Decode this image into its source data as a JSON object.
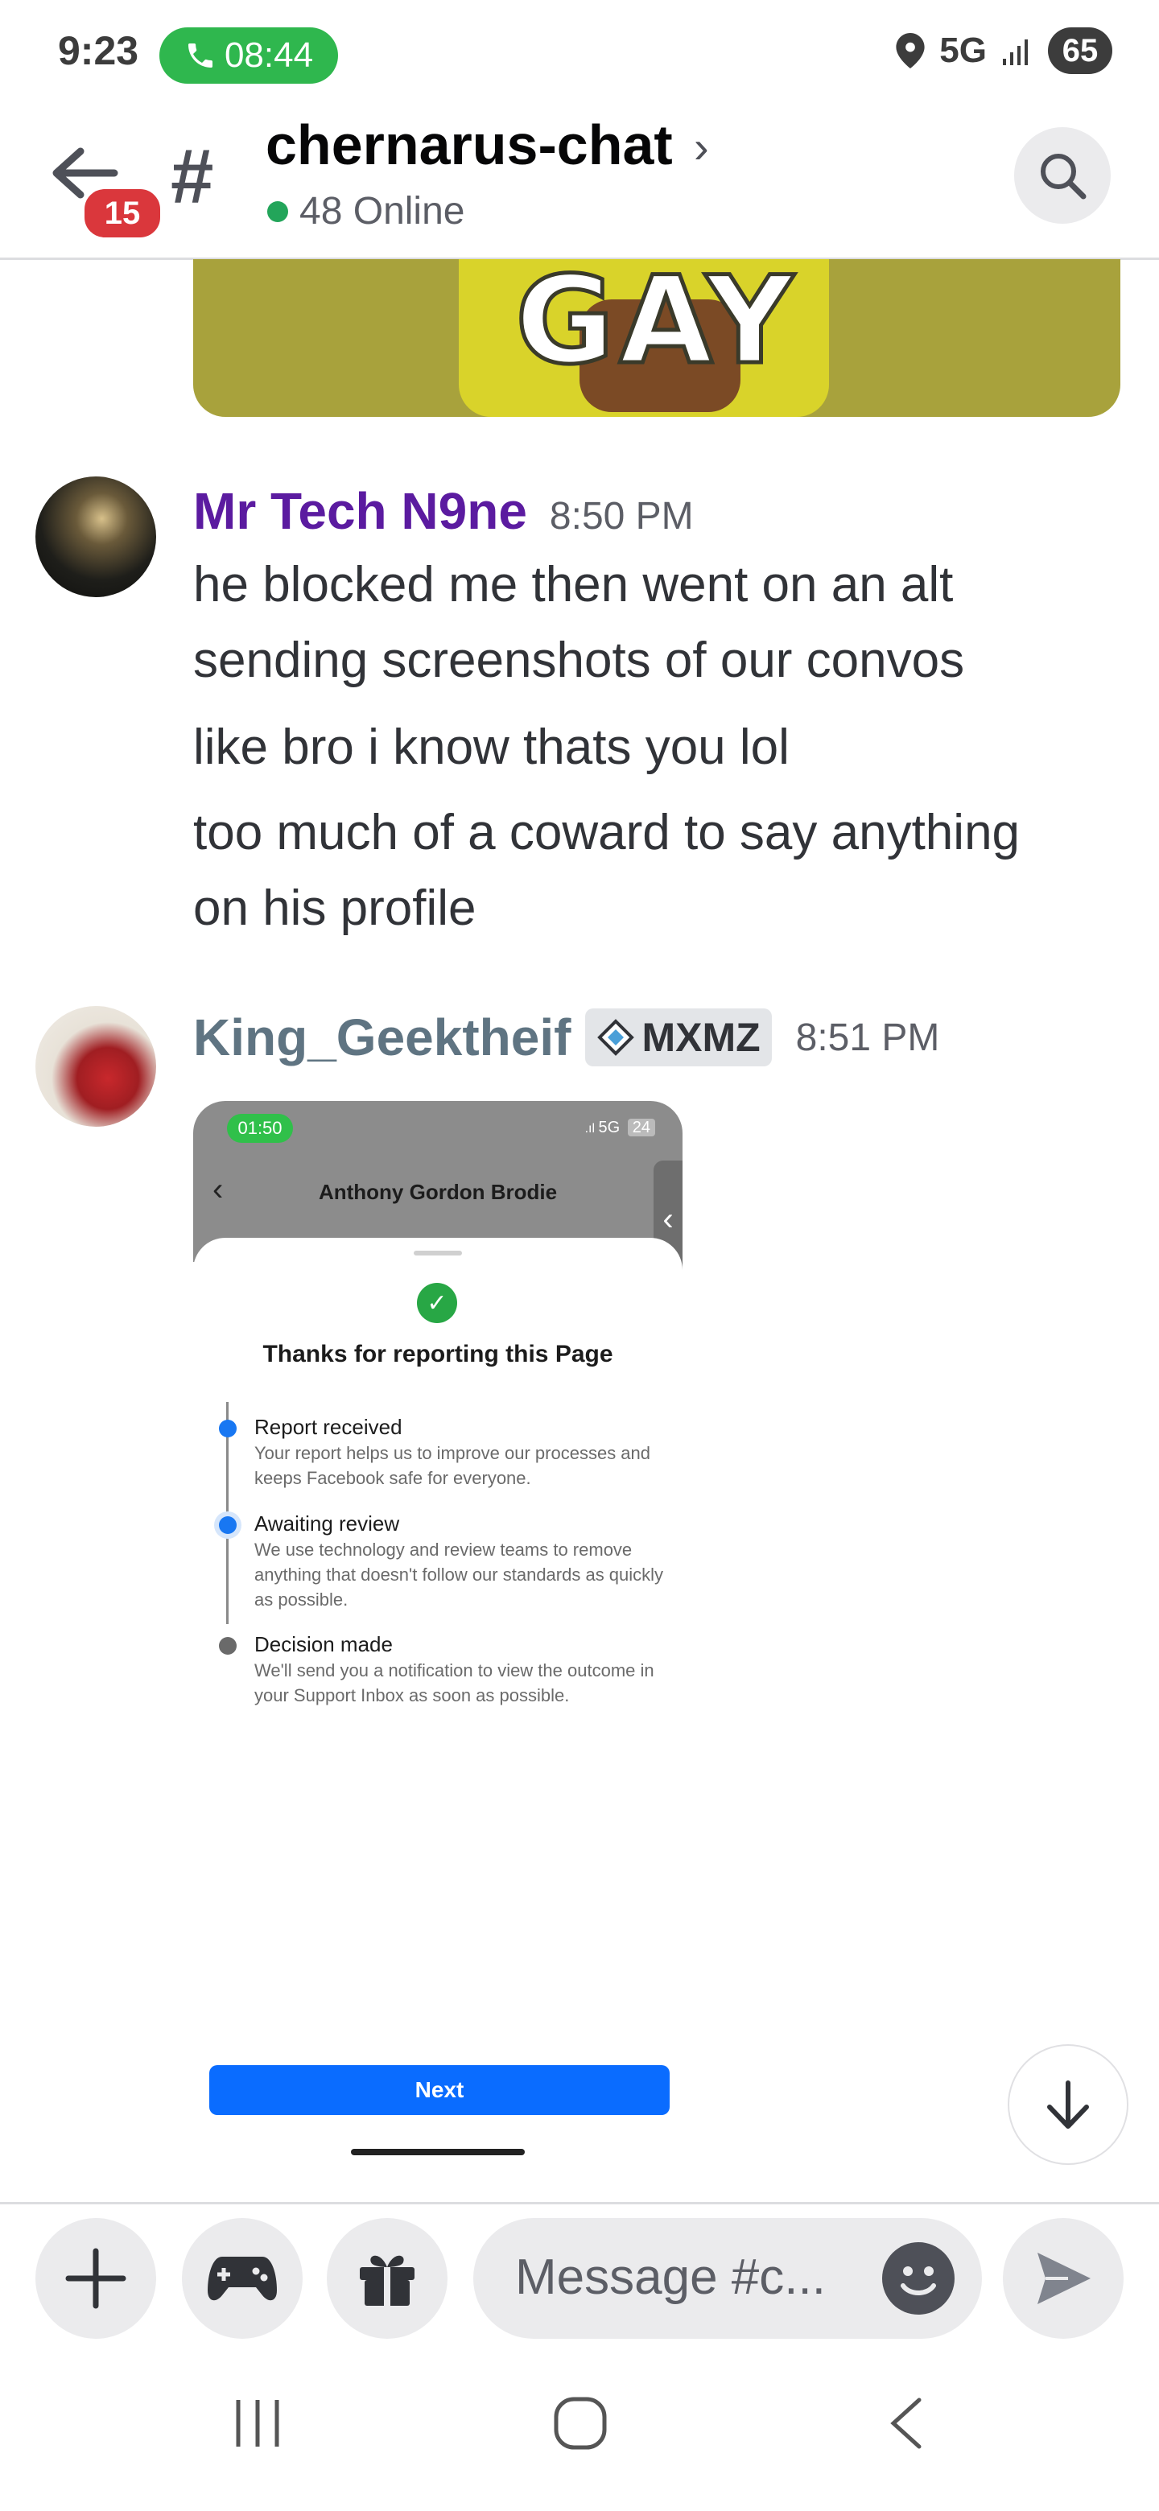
{
  "status_bar": {
    "time": "9:23",
    "call_timer": "08:44",
    "network": "5G",
    "battery": "65"
  },
  "header": {
    "back_badge": "15",
    "channel_name": "chernarus-chat",
    "online_text": "48 Online"
  },
  "top_image": {
    "caption_text": "GAY"
  },
  "messages": [
    {
      "username": "Mr Tech N9ne",
      "username_color": "#5b1ba0",
      "time": "8:50 PM",
      "lines": [
        "he blocked me then went on an alt",
        "sending screenshots of our convos",
        "like bro i know thats you lol",
        "too much of a coward to say anything",
        "on his profile"
      ]
    },
    {
      "username": "King_Geektheif",
      "username_color": "#5f7482",
      "tag": "MXMZ",
      "time": "8:51 PM"
    }
  ],
  "attachment": {
    "status_time": "01:50",
    "status_network": "5G",
    "status_battery": "24",
    "page_title": "Anthony Gordon Brodie",
    "sheet_title": "Thanks for reporting this Page",
    "steps": [
      {
        "title": "Report received",
        "desc": "Your report helps us to improve our processes and keeps Facebook safe for everyone."
      },
      {
        "title": "Awaiting review",
        "desc": "We use technology and review teams to remove anything that doesn't follow our standards as quickly as possible."
      },
      {
        "title": "Decision made",
        "desc": "We'll send you a notification to view the outcome in your Support Inbox as soon as possible."
      }
    ],
    "next_label": "Next"
  },
  "composer": {
    "placeholder": "Message #c..."
  },
  "colors": {
    "online": "#23a55a",
    "badge": "#da373c",
    "call_pill": "#2fb74e",
    "next_button": "#0a6cff"
  }
}
